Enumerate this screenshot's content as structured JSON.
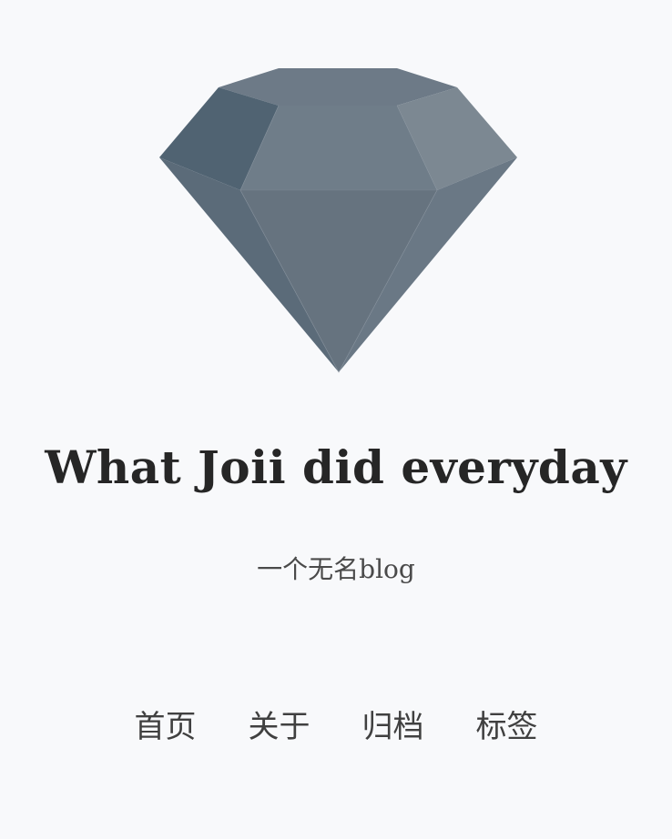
{
  "site": {
    "title": "What Joii did everyday",
    "subtitle": "一个无名blog"
  },
  "logo": {
    "icon": "diamond-icon",
    "colors": {
      "top_left": "#506372",
      "top": "#6d7a87",
      "top_right": "#7c8892",
      "crown_center": "#6f7d89",
      "pavilion_left": "#5b6b79",
      "pavilion_center": "#66737f",
      "pavilion_right": "#6a7885"
    }
  },
  "nav": {
    "items": [
      {
        "label": "首页"
      },
      {
        "label": "关于"
      },
      {
        "label": "归档"
      },
      {
        "label": "标签"
      }
    ]
  }
}
